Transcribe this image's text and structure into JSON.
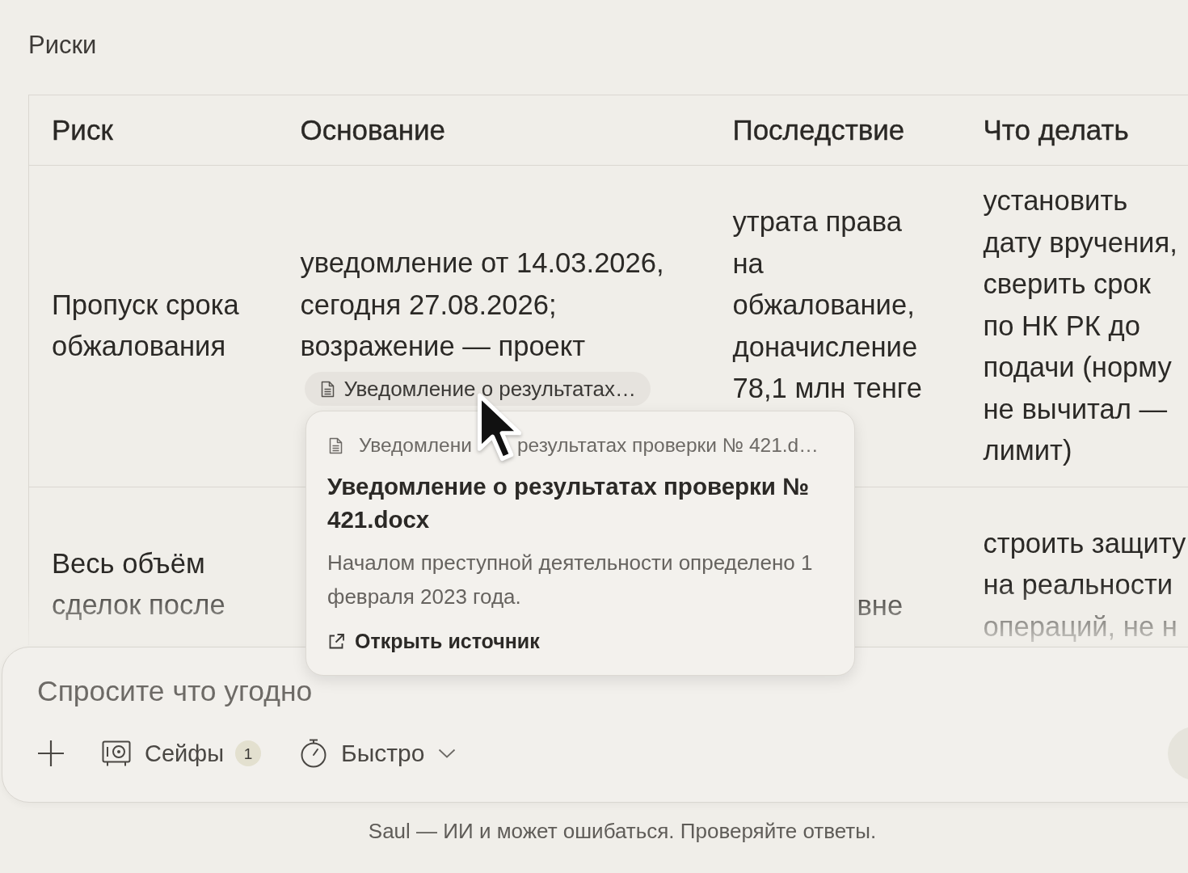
{
  "section_title": "Риски",
  "risks_table": {
    "columns": [
      "Риск",
      "Основание",
      "Последствие",
      "Что делать"
    ],
    "rows": [
      {
        "risk": "Пропуск срока обжалования",
        "basis": "уведомление от 14.03.2026, сегодня 27.08.2026; возражение — проект",
        "basis_source": "Уведомление о результатах…",
        "consequence": "утрата права на обжалование, доначисление 78,1 млн тенге",
        "action": "установить дату вручения, сверить срок по НК РК до подачи (норму не вычитал — лимит)"
      },
      {
        "risk": "Весь объём сделок после",
        "consequence": "вне",
        "action": "строить защиту на реальности операций, не н"
      }
    ]
  },
  "source_popover": {
    "file_label_parts": [
      "Уведомлени",
      "результатах проверки № 421.d…"
    ],
    "title": "Уведомление о результатах проверки № 421.docx",
    "excerpt": "Началом преступной деятельности определено 1 февраля 2023 года.",
    "open_link": "Открыть источник"
  },
  "composer": {
    "placeholder": "Спросите что угодно",
    "tools": [
      {
        "kind": "add"
      },
      {
        "kind": "counter",
        "label": "Сейфы",
        "count": "1"
      },
      {
        "kind": "dropdown",
        "label": "Быстро"
      }
    ]
  },
  "footer_note": "Saul — ИИ и может ошибаться. Проверяйте ответы."
}
